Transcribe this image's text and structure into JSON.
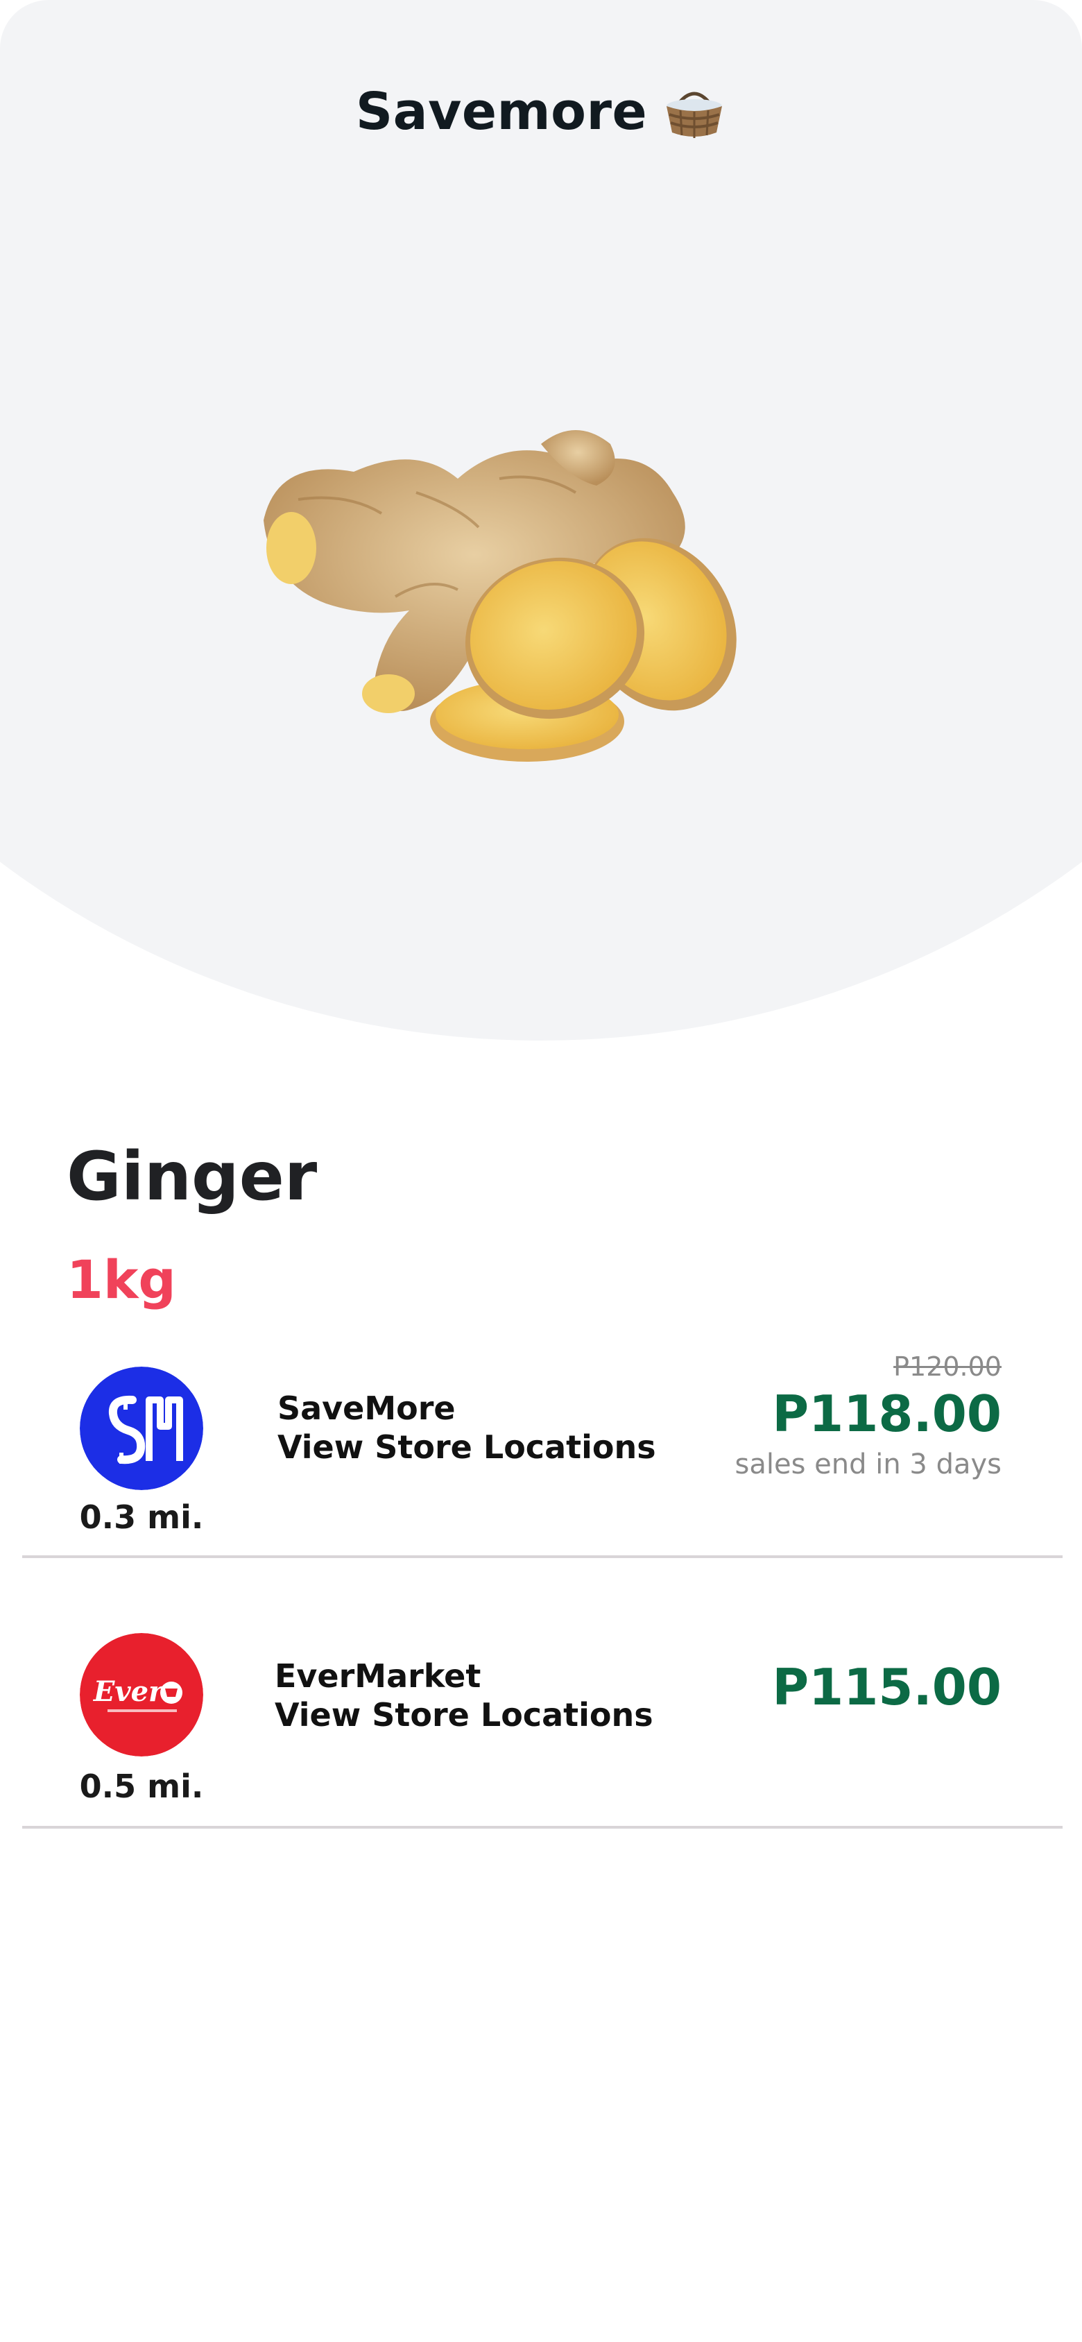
{
  "header": {
    "title": "Savemore",
    "title_icon": "basket-icon"
  },
  "product": {
    "image": "ginger-photo",
    "name": "Ginger",
    "size": "1kg"
  },
  "offers": [
    {
      "store_name": "SaveMore",
      "link_label": "View Store Locations",
      "distance": "0.3 mi.",
      "old_price": "P120.00",
      "price": "P118.00",
      "sale_note": "sales end in 3 days",
      "logo": "sm-logo",
      "logo_color": "#1c2ee6"
    },
    {
      "store_name": "EverMarket",
      "link_label": "View Store Locations",
      "distance": "0.5 mi.",
      "price": "P115.00",
      "logo": "ever-logo",
      "logo_color": "#e8202d"
    }
  ],
  "colors": {
    "price": "#0c6a45",
    "size_accent": "#f0425a",
    "hero_bg": "#f3f4f6"
  }
}
